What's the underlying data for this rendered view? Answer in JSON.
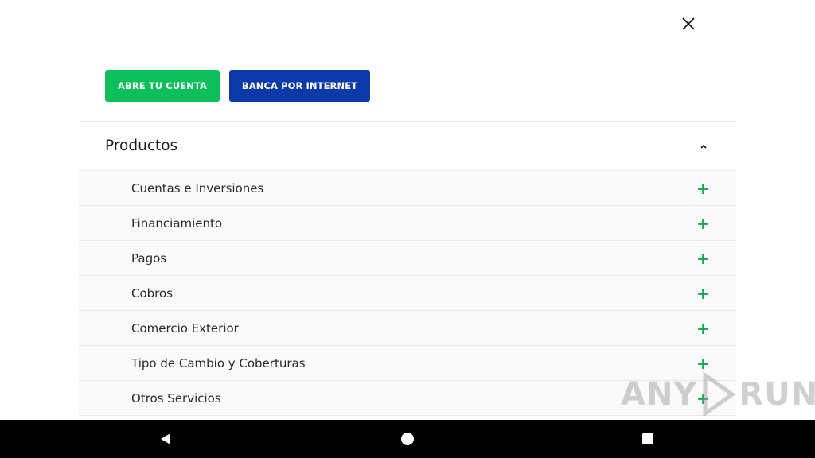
{
  "buttons": {
    "open_account": "ABRE TU CUENTA",
    "online_banking": "BANCA POR INTERNET"
  },
  "menu": {
    "section_title": "Productos",
    "items": [
      {
        "label": "Cuentas e Inversiones"
      },
      {
        "label": "Financiamiento"
      },
      {
        "label": "Pagos"
      },
      {
        "label": "Cobros"
      },
      {
        "label": "Comercio Exterior"
      },
      {
        "label": "Tipo de Cambio y Coberturas"
      },
      {
        "label": "Otros Servicios"
      }
    ],
    "expand_symbol": "+"
  },
  "watermark": {
    "left": "ANY",
    "right": "RUN"
  },
  "colors": {
    "green": "#0cbf5a",
    "blue": "#0b3aa8",
    "plus": "#13a84f"
  },
  "icons": [
    "close-icon",
    "chevron-up-icon",
    "plus-icon",
    "back-icon",
    "home-icon",
    "recents-icon"
  ]
}
